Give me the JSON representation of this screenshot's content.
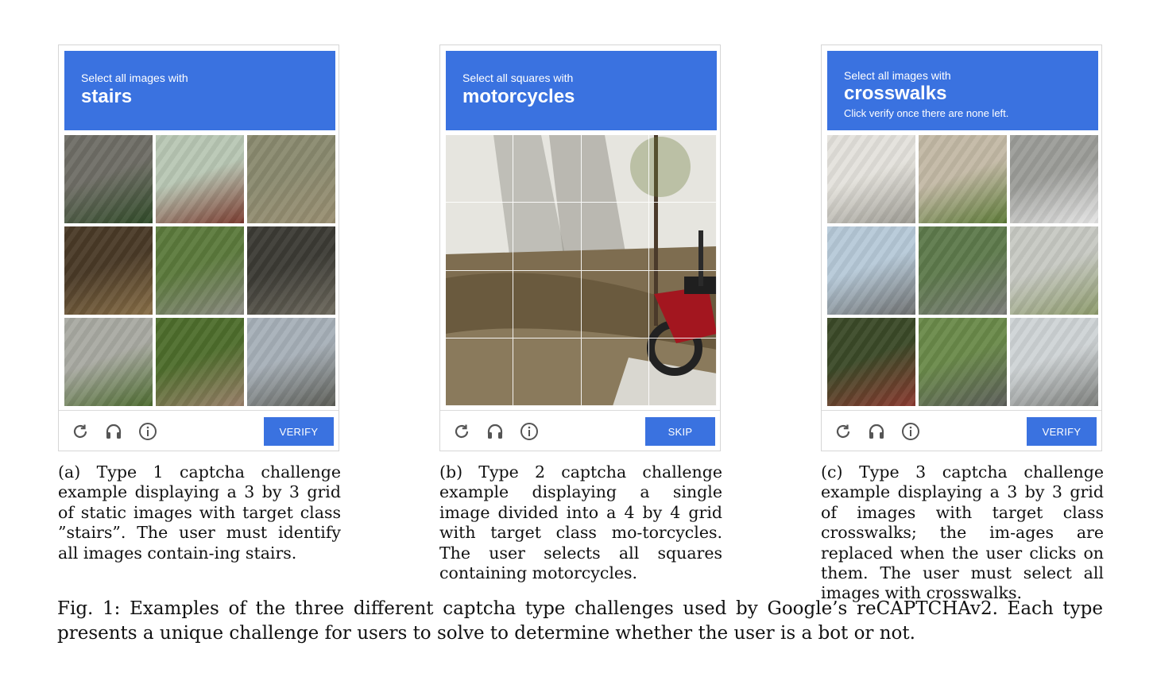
{
  "panels": [
    {
      "prompt": "Select all images with",
      "target": "stairs",
      "note": "",
      "grid_size": 3,
      "button_label": "VERIFY",
      "caption": "(a) Type 1 captcha challenge example displaying a 3 by 3 grid of static images with target class ”stairs”. The user must identify all images contain-ing stairs.",
      "tiles": [
        {
          "name": "tile-house-bush",
          "colors": [
            "#6f6e66",
            "#2f4a27"
          ]
        },
        {
          "name": "tile-red-shed",
          "colors": [
            "#b8c7b4",
            "#7a3a2e"
          ]
        },
        {
          "name": "tile-porch-steps",
          "colors": [
            "#8a8a6f",
            "#9a8f72"
          ]
        },
        {
          "name": "tile-wooden-crate",
          "colors": [
            "#4a3a27",
            "#8a7048"
          ]
        },
        {
          "name": "tile-garden-stairs",
          "colors": [
            "#5c7a3c",
            "#8b8a82"
          ]
        },
        {
          "name": "tile-concrete-stairs",
          "colors": [
            "#3c3b35",
            "#6e6a5e"
          ]
        },
        {
          "name": "tile-person-fence",
          "colors": [
            "#a9aaa2",
            "#4c6b2e"
          ]
        },
        {
          "name": "tile-hill-stairs",
          "colors": [
            "#4e6e2c",
            "#9a7f6a"
          ]
        },
        {
          "name": "tile-street-houses",
          "colors": [
            "#a7b0b8",
            "#5b5c55"
          ]
        }
      ]
    },
    {
      "prompt": "Select all squares with",
      "target": "motorcycles",
      "note": "",
      "grid_size": 4,
      "button_label": "SKIP",
      "caption": "(b) Type 2 captcha challenge example displaying a single image divided into a 4 by 4 grid with target class mo-torcycles. The user selects all squares containing motorcycles."
    },
    {
      "prompt": "Select all images with",
      "target": "crosswalks",
      "note": "Click verify once there are none left.",
      "grid_size": 3,
      "button_label": "VERIFY",
      "caption": "(c) Type 3 captcha challenge example displaying a 3 by 3 grid of images with target class crosswalks; the im-ages are replaced when the user clicks on them. The user must select all images with crosswalks.",
      "tiles": [
        {
          "name": "tile-white-building",
          "colors": [
            "#e4e2dc",
            "#9c9a92"
          ]
        },
        {
          "name": "tile-street-trees",
          "colors": [
            "#c3b9a5",
            "#5c7a36"
          ]
        },
        {
          "name": "tile-crosswalk-street",
          "colors": [
            "#9c9d99",
            "#e6e6e6"
          ]
        },
        {
          "name": "tile-intersection-car",
          "colors": [
            "#b6c9d8",
            "#6d6f6f"
          ]
        },
        {
          "name": "tile-road-crosswalk",
          "colors": [
            "#5e7a4c",
            "#7c7d7a"
          ]
        },
        {
          "name": "tile-curved-road",
          "colors": [
            "#c7c9c3",
            "#8c9a6a"
          ]
        },
        {
          "name": "tile-tree-sign",
          "colors": [
            "#3b4a28",
            "#8c3a30"
          ]
        },
        {
          "name": "tile-road-car",
          "colors": [
            "#6a8a4a",
            "#5c5d5a"
          ]
        },
        {
          "name": "tile-parking-car",
          "colors": [
            "#cfd4d6",
            "#7b7d7a"
          ]
        }
      ]
    }
  ],
  "figure_caption": "Fig. 1: Examples of the three different captcha type challenges used by Google’s reCAPTCHAv2. Each type presents a unique challenge for users to solve to determine whether the user is a bot or not."
}
